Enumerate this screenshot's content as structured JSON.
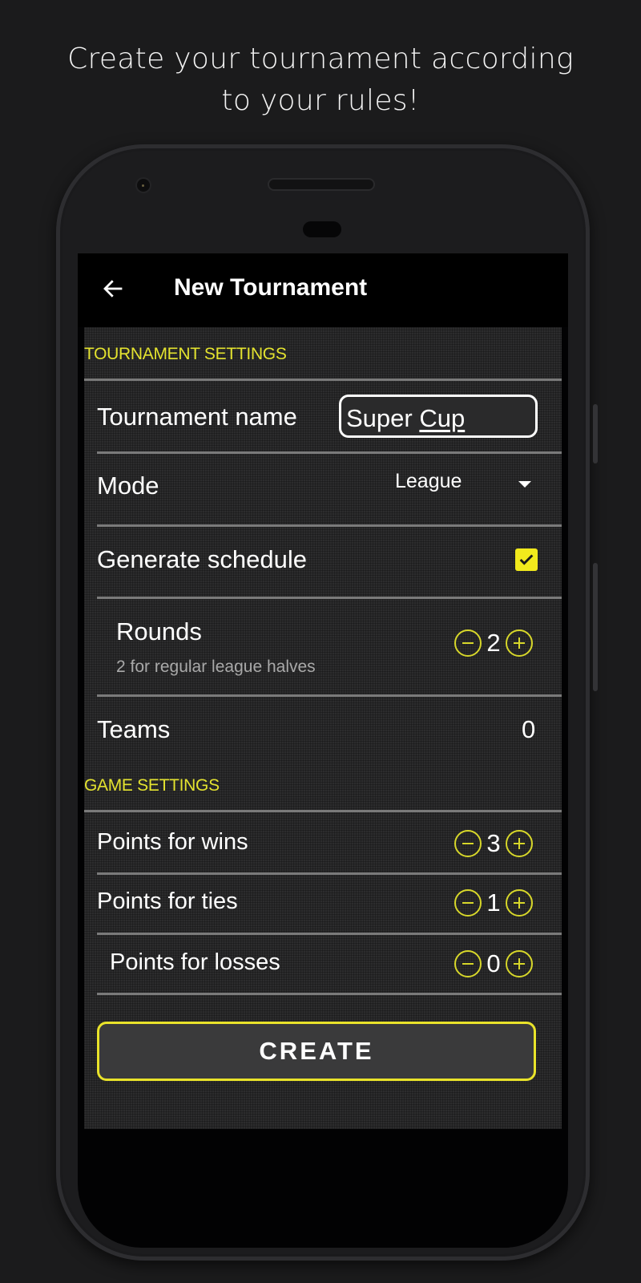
{
  "promo": {
    "headline_line1": "Create your tournament according",
    "headline_line2": "to your rules!"
  },
  "appbar": {
    "back_icon": "arrow-left-icon",
    "title": "New Tournament"
  },
  "tournament_settings": {
    "section_title": "TOURNAMENT SETTINGS",
    "name": {
      "label": "Tournament name",
      "value_part1": "Super ",
      "value_part2": "Cup"
    },
    "mode": {
      "label": "Mode",
      "value": "League",
      "icon": "dropdown-caret-icon"
    },
    "generate_schedule": {
      "label": "Generate schedule",
      "checked": true
    },
    "rounds": {
      "label": "Rounds",
      "hint": "2 for regular league halves",
      "value": "2"
    },
    "teams": {
      "label": "Teams",
      "value": "0"
    }
  },
  "game_settings": {
    "section_title": "GAME SETTINGS",
    "wins": {
      "label": "Points for wins",
      "value": "3"
    },
    "ties": {
      "label": "Points for ties",
      "value": "1"
    },
    "losses": {
      "label": "Points for losses",
      "value": "0"
    }
  },
  "actions": {
    "create_label": "CREATE"
  },
  "colors": {
    "accent": "#e9e32a",
    "background": "#1b1b1c",
    "panel": "#2c2c2d",
    "appbar": "#000000"
  }
}
